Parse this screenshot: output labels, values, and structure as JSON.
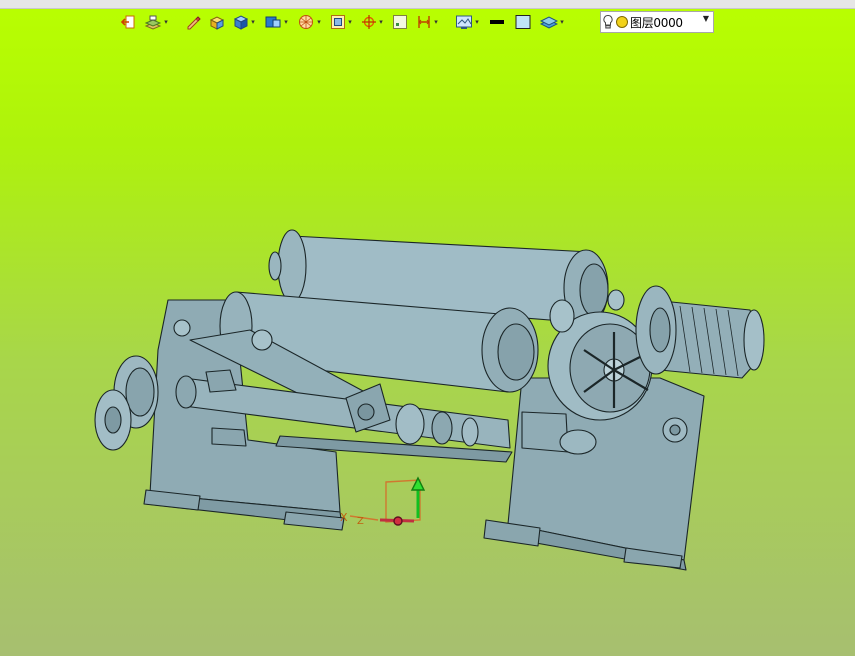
{
  "toolbar": {
    "items": [
      {
        "icon": "exit-sketch-icon",
        "dropdown": false
      },
      {
        "icon": "layers-stack-icon",
        "dropdown": true
      },
      {
        "icon": "pen-icon",
        "dropdown": false
      },
      {
        "icon": "cube-yellow-icon",
        "dropdown": false
      },
      {
        "icon": "cube-blue-icon",
        "dropdown": true
      },
      {
        "icon": "view-cube-icon",
        "dropdown": true
      },
      {
        "icon": "sphere-render-icon",
        "dropdown": true
      },
      {
        "icon": "square-frame-icon",
        "dropdown": true
      },
      {
        "icon": "snap-target-icon",
        "dropdown": true
      },
      {
        "icon": "grid-toggle-icon",
        "dropdown": false
      },
      {
        "icon": "dimension-icon",
        "dropdown": true
      },
      {
        "icon": "display-settings-icon",
        "dropdown": true
      },
      {
        "icon": "line-weight-icon",
        "dropdown": false
      },
      {
        "icon": "fill-color-icon",
        "dropdown": false
      },
      {
        "icon": "layer-manager-icon",
        "dropdown": true
      }
    ]
  },
  "layer_selector": {
    "value": "图层0000",
    "icons": [
      "lightbulb-icon",
      "layer-color-dot-icon"
    ]
  },
  "viewport": {
    "background_top": "#b9ff00",
    "background_bottom": "#a7bf70",
    "model_color": "#90aeb8",
    "triad_axes": [
      "X",
      "Z"
    ]
  }
}
